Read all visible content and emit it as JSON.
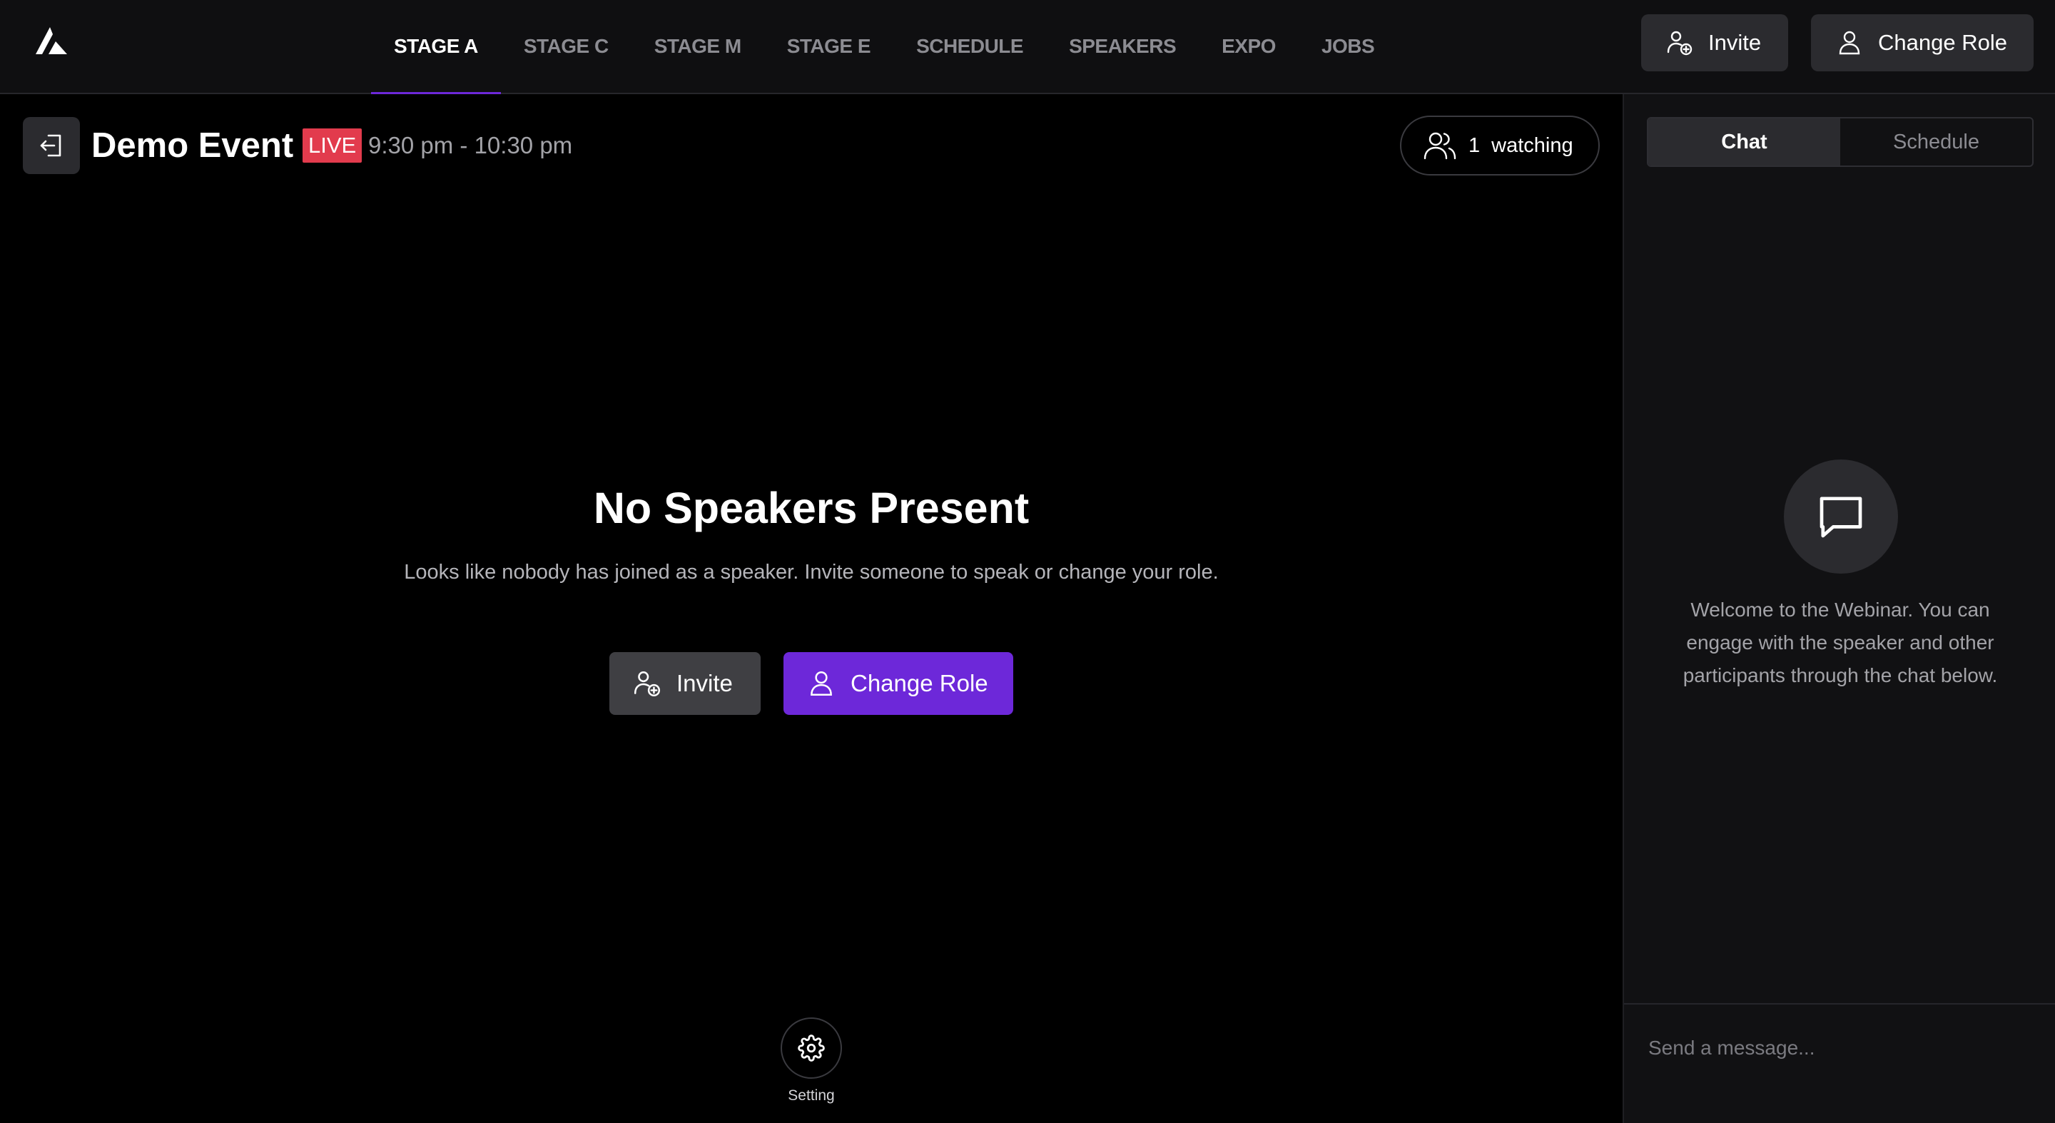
{
  "nav": {
    "tabs": [
      {
        "label": "STAGE A",
        "active": true
      },
      {
        "label": "STAGE C",
        "active": false
      },
      {
        "label": "STAGE M",
        "active": false
      },
      {
        "label": "STAGE E",
        "active": false
      },
      {
        "label": "SCHEDULE",
        "active": false
      },
      {
        "label": "SPEAKERS",
        "active": false
      },
      {
        "label": "EXPO",
        "active": false
      },
      {
        "label": "JOBS",
        "active": false
      }
    ],
    "invite_label": "Invite",
    "change_role_label": "Change Role"
  },
  "stage": {
    "title": "Demo Event",
    "live_badge": "LIVE",
    "time": "9:30 pm - 10:30 pm",
    "watching_count": "1",
    "watching_label": "watching"
  },
  "empty_state": {
    "title": "No Speakers Present",
    "subtitle": "Looks like nobody has joined as a speaker. Invite someone to speak or change your role.",
    "invite_label": "Invite",
    "change_role_label": "Change Role"
  },
  "settings": {
    "label": "Setting"
  },
  "side_panel": {
    "tabs": [
      {
        "label": "Chat",
        "active": true
      },
      {
        "label": "Schedule",
        "active": false
      }
    ],
    "welcome_text": "Welcome to the Webinar. You can engage with the speaker and other participants through the chat below.",
    "message_placeholder": "Send a message..."
  },
  "colors": {
    "accent": "#6d28d9",
    "live": "#e23b4d",
    "background": "#000000",
    "panel": "#111113"
  },
  "icons": [
    "app-logo-icon",
    "user-plus-icon",
    "user-icon",
    "exit-icon",
    "users-icon",
    "gear-icon",
    "chat-bubble-icon"
  ]
}
